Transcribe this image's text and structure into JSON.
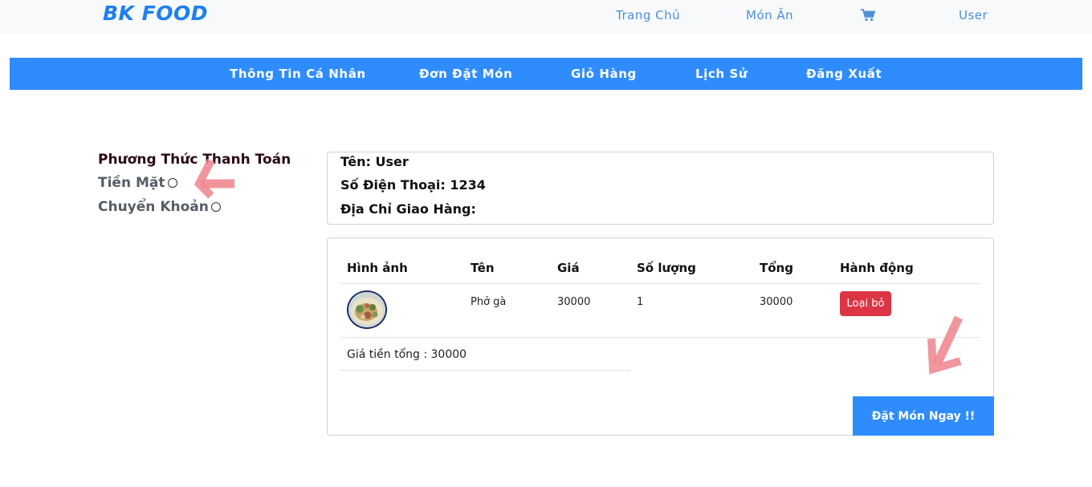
{
  "header": {
    "logo": "BK FOOD",
    "nav": [
      "Trang Chủ",
      "Món Ăn",
      "User"
    ],
    "cart_icon": "shopping-cart-icon"
  },
  "subnav": [
    "Thông Tin Cá Nhân",
    "Đơn Đặt Món",
    "Giỏ Hàng",
    "Lịch Sử",
    "Đăng Xuất"
  ],
  "payment": {
    "title": "Phương Thức Thanh Toán",
    "options": [
      "Tiền Mặt",
      "Chuyển Khoản"
    ]
  },
  "user_info": {
    "name": "Tên: User",
    "phone": "Số Điện Thoại: 1234",
    "address": "Địa Chỉ Giao Hàng:"
  },
  "cart": {
    "headers": [
      "Hình ảnh",
      "Tên",
      "Giá",
      "Số lượng",
      "Tổng",
      "Hành động"
    ],
    "rows": [
      {
        "name": "Phở gà",
        "price": "30000",
        "quantity": "1",
        "total": "30000",
        "action": "Loại bỏ"
      }
    ],
    "grand_total": "Giá tiền tổng : 30000",
    "order_button": "Đặt Món Ngay !!"
  },
  "colors": {
    "brand": "#1e7ff0",
    "nav_bar": "#2e8cff",
    "remove": "#dc3545",
    "annotation_arrow": "#f08a93"
  }
}
